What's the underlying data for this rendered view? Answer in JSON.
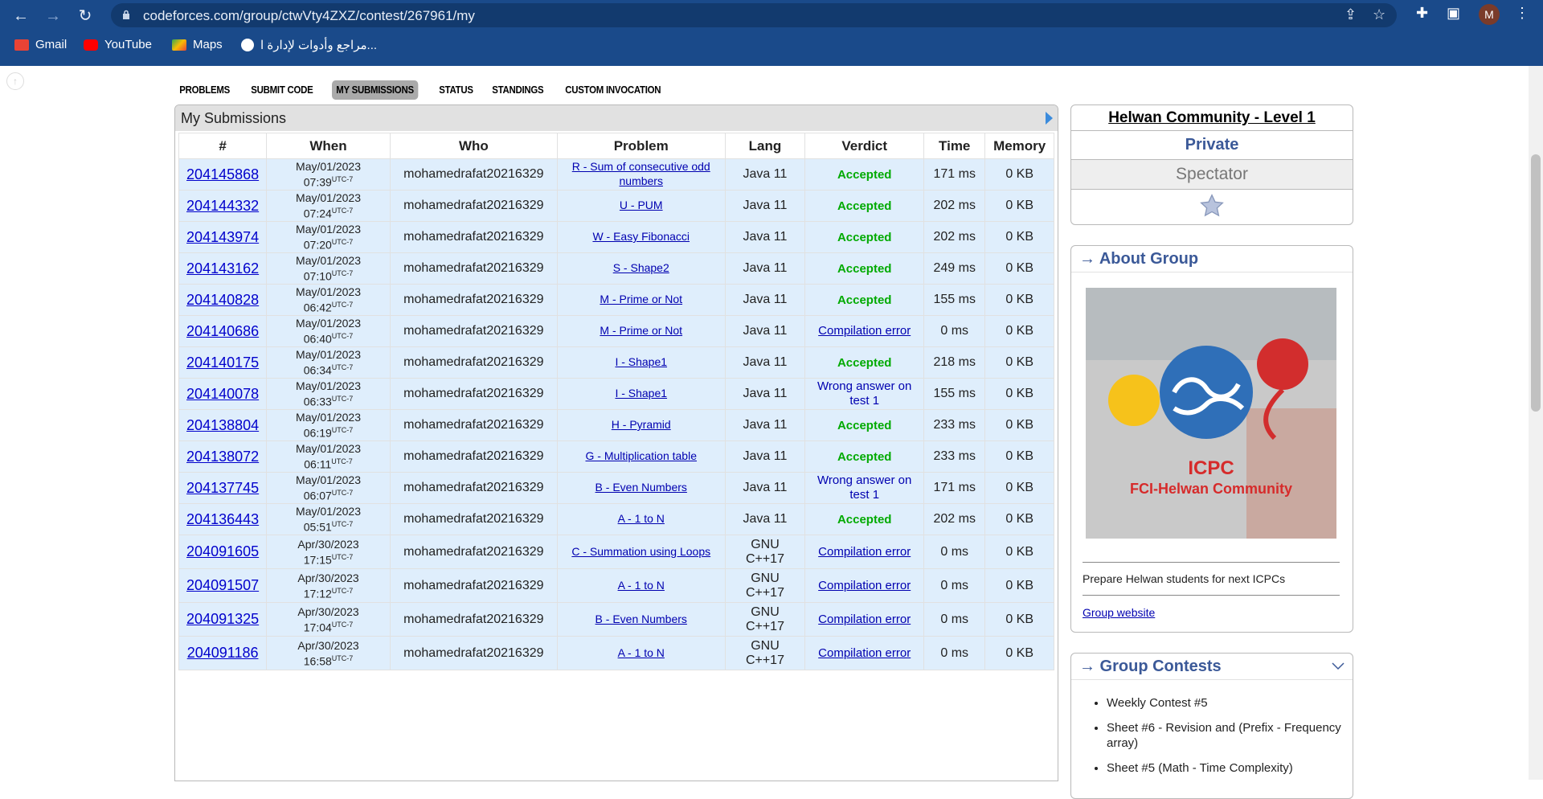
{
  "browser": {
    "url": "codeforces.com/group/ctwVty4ZXZ/contest/267961/my",
    "profile_initial": "M",
    "bookmarks": [
      "Gmail",
      "YouTube",
      "Maps",
      "مراجع وأدوات لإدارة ا..."
    ]
  },
  "menu": [
    "Problems",
    "Submit Code",
    "My Submissions",
    "Status",
    "Standings",
    "Custom Invocation"
  ],
  "submissions": {
    "title": "My Submissions",
    "headers": [
      "#",
      "When",
      "Who",
      "Problem",
      "Lang",
      "Verdict",
      "Time",
      "Memory"
    ],
    "rows": [
      {
        "id": "204145868",
        "date": "May/01/2023",
        "time": "07:39",
        "tz": "UTC-7",
        "who": "mohamedrafat20216329",
        "problem": "R - Sum of consecutive odd numbers",
        "lang": "Java 11",
        "verdict": "Accepted",
        "t": "171 ms",
        "mem": "0 KB"
      },
      {
        "id": "204144332",
        "date": "May/01/2023",
        "time": "07:24",
        "tz": "UTC-7",
        "who": "mohamedrafat20216329",
        "problem": "U - PUM",
        "lang": "Java 11",
        "verdict": "Accepted",
        "t": "202 ms",
        "mem": "0 KB"
      },
      {
        "id": "204143974",
        "date": "May/01/2023",
        "time": "07:20",
        "tz": "UTC-7",
        "who": "mohamedrafat20216329",
        "problem": "W - Easy Fibonacci",
        "lang": "Java 11",
        "verdict": "Accepted",
        "t": "202 ms",
        "mem": "0 KB"
      },
      {
        "id": "204143162",
        "date": "May/01/2023",
        "time": "07:10",
        "tz": "UTC-7",
        "who": "mohamedrafat20216329",
        "problem": "S - Shape2",
        "lang": "Java 11",
        "verdict": "Accepted",
        "t": "249 ms",
        "mem": "0 KB"
      },
      {
        "id": "204140828",
        "date": "May/01/2023",
        "time": "06:42",
        "tz": "UTC-7",
        "who": "mohamedrafat20216329",
        "problem": "M - Prime or Not",
        "lang": "Java 11",
        "verdict": "Accepted",
        "t": "155 ms",
        "mem": "0 KB"
      },
      {
        "id": "204140686",
        "date": "May/01/2023",
        "time": "06:40",
        "tz": "UTC-7",
        "who": "mohamedrafat20216329",
        "problem": "M - Prime or Not",
        "lang": "Java 11",
        "verdict": "Compilation error",
        "t": "0 ms",
        "mem": "0 KB"
      },
      {
        "id": "204140175",
        "date": "May/01/2023",
        "time": "06:34",
        "tz": "UTC-7",
        "who": "mohamedrafat20216329",
        "problem": "I - Shape1",
        "lang": "Java 11",
        "verdict": "Accepted",
        "t": "218 ms",
        "mem": "0 KB"
      },
      {
        "id": "204140078",
        "date": "May/01/2023",
        "time": "06:33",
        "tz": "UTC-7",
        "who": "mohamedrafat20216329",
        "problem": "I - Shape1",
        "lang": "Java 11",
        "verdict": "Wrong answer on test 1",
        "t": "155 ms",
        "mem": "0 KB"
      },
      {
        "id": "204138804",
        "date": "May/01/2023",
        "time": "06:19",
        "tz": "UTC-7",
        "who": "mohamedrafat20216329",
        "problem": "H - Pyramid",
        "lang": "Java 11",
        "verdict": "Accepted",
        "t": "233 ms",
        "mem": "0 KB"
      },
      {
        "id": "204138072",
        "date": "May/01/2023",
        "time": "06:11",
        "tz": "UTC-7",
        "who": "mohamedrafat20216329",
        "problem": "G - Multiplication table",
        "lang": "Java 11",
        "verdict": "Accepted",
        "t": "233 ms",
        "mem": "0 KB"
      },
      {
        "id": "204137745",
        "date": "May/01/2023",
        "time": "06:07",
        "tz": "UTC-7",
        "who": "mohamedrafat20216329",
        "problem": "B - Even Numbers",
        "lang": "Java 11",
        "verdict": "Wrong answer on test 1",
        "t": "171 ms",
        "mem": "0 KB"
      },
      {
        "id": "204136443",
        "date": "May/01/2023",
        "time": "05:51",
        "tz": "UTC-7",
        "who": "mohamedrafat20216329",
        "problem": "A - 1 to N",
        "lang": "Java 11",
        "verdict": "Accepted",
        "t": "202 ms",
        "mem": "0 KB"
      },
      {
        "id": "204091605",
        "date": "Apr/30/2023",
        "time": "17:15",
        "tz": "UTC-7",
        "who": "mohamedrafat20216329",
        "problem": "C - Summation using Loops",
        "lang": "GNU C++17",
        "verdict": "Compilation error",
        "t": "0 ms",
        "mem": "0 KB"
      },
      {
        "id": "204091507",
        "date": "Apr/30/2023",
        "time": "17:12",
        "tz": "UTC-7",
        "who": "mohamedrafat20216329",
        "problem": "A - 1 to N",
        "lang": "GNU C++17",
        "verdict": "Compilation error",
        "t": "0 ms",
        "mem": "0 KB"
      },
      {
        "id": "204091325",
        "date": "Apr/30/2023",
        "time": "17:04",
        "tz": "UTC-7",
        "who": "mohamedrafat20216329",
        "problem": "B - Even Numbers",
        "lang": "GNU C++17",
        "verdict": "Compilation error",
        "t": "0 ms",
        "mem": "0 KB"
      },
      {
        "id": "204091186",
        "date": "Apr/30/2023",
        "time": "16:58",
        "tz": "UTC-7",
        "who": "mohamedrafat20216329",
        "problem": "A - 1 to N",
        "lang": "GNU C++17",
        "verdict": "Compilation error",
        "t": "0 ms",
        "mem": "0 KB"
      }
    ]
  },
  "sidebar": {
    "contest_title": "Helwan Community - Level 1",
    "visibility": "Private",
    "role": "Spectator",
    "about_title": "→ About Group",
    "logo_text": [
      "ICPC",
      "FCI-Helwan Community"
    ],
    "description": "Prepare Helwan students for next ICPCs",
    "group_website": "Group website",
    "contests_title": "→ Group Contests",
    "contests": [
      "Weekly Contest #5",
      "Sheet #6 - Revision and (Prefix - Frequency array)",
      "Sheet #5 (Math - Time Complexity)"
    ]
  },
  "colors": {
    "accepted": "#00a000",
    "link": "#0000b0",
    "row_bg": "#dfeefc",
    "browser": "#1a4a8a"
  }
}
